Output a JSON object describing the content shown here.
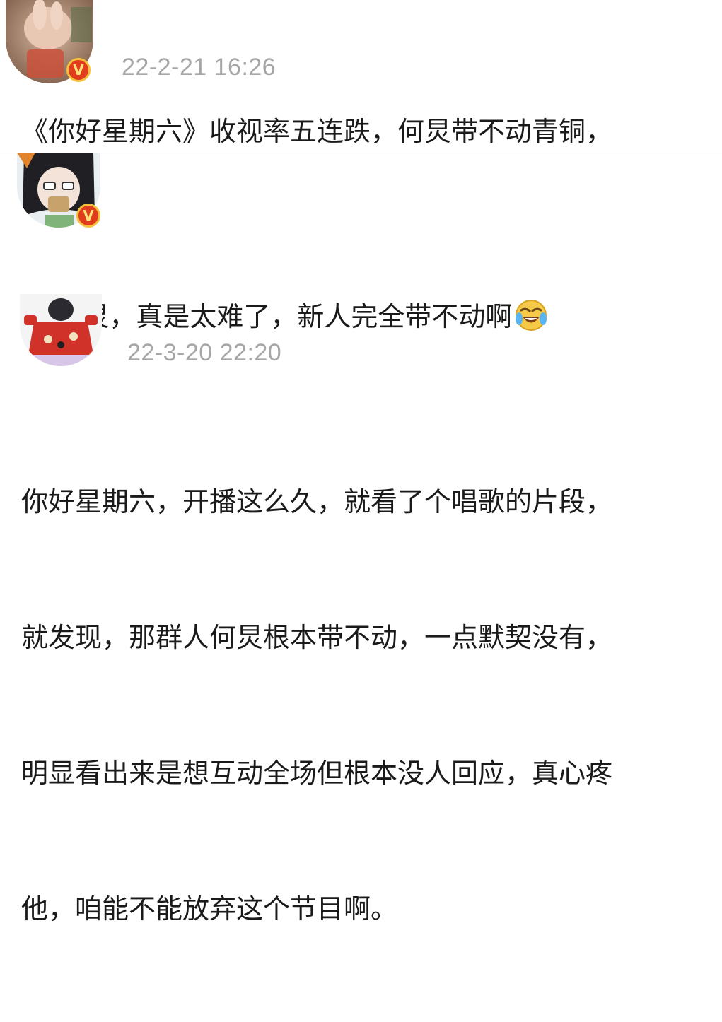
{
  "posts": [
    {
      "timestamp": "22-2-21 16:26",
      "verified": "V",
      "text": "《你好星期六》收视率五连跌，何炅带不动青铜，"
    },
    {
      "verified": "V",
      "text": "何炅，真是太难了，新人完全带不动啊",
      "emoji": "laughing-crying-icon"
    },
    {
      "timestamp": "22-3-20 22:20",
      "text_lines": [
        "你好星期六，开播这么久，就看了个唱歌的片段，",
        "就发现，那群人何炅根本带不动，一点默契没有，",
        "明显看出来是想互动全场但根本没人回应，真心疼",
        "他，咱能不能放弃这个节目啊。"
      ]
    }
  ],
  "colors": {
    "timestamp": "#a6a6a6",
    "text": "#1a1a1a",
    "badge_red": "#e03d1d",
    "badge_gold": "#f6c23b"
  }
}
